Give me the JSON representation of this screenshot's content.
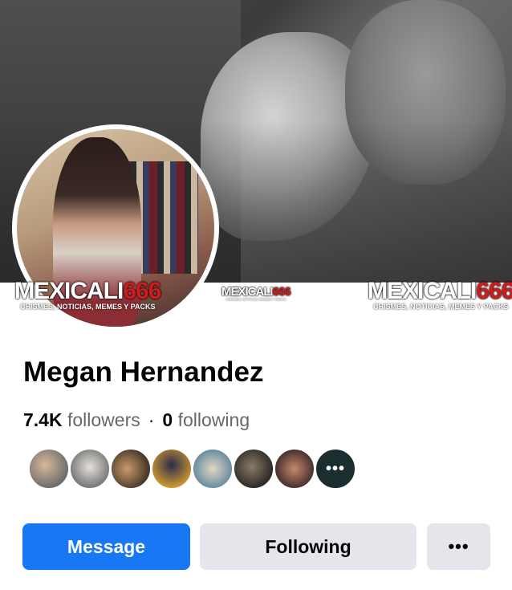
{
  "profile": {
    "name": "Megan Hernandez",
    "followers_count": "7.4K",
    "followers_label": "followers",
    "separator": "·",
    "following_count": "0",
    "following_label": "following"
  },
  "watermark": {
    "brand_text": "MEXICALI",
    "brand_number": "666",
    "tagline": "CHISMES, NOTICIAS, MEMES Y PACKS"
  },
  "mutual_friends": {
    "avatars": [
      "friend-avatar",
      "friend-avatar",
      "friend-avatar",
      "friend-avatar",
      "friend-avatar",
      "friend-avatar",
      "friend-avatar"
    ],
    "more_label": "•••"
  },
  "actions": {
    "message_label": "Message",
    "following_label": "Following",
    "more_label": "•••"
  },
  "colors": {
    "primary_button": "#1877f2",
    "secondary_button": "#e4e6eb",
    "watermark_red": "#d21a1a"
  }
}
